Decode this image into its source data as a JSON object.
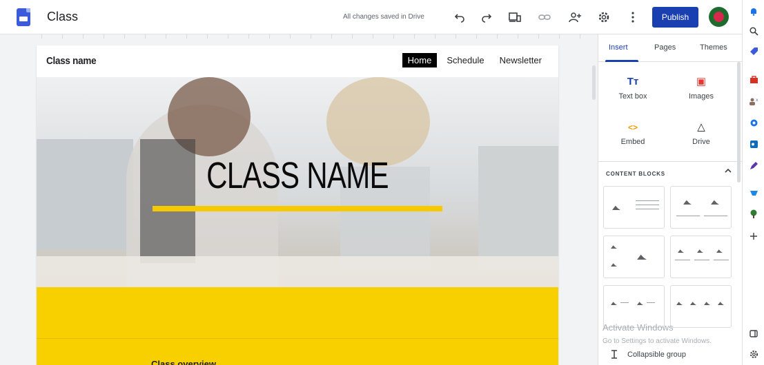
{
  "app": {
    "title": "Class",
    "save_status": "All changes saved in Drive",
    "publish_label": "Publish"
  },
  "toolbar": {
    "undo_icon": "undo-icon",
    "redo_icon": "redo-icon",
    "preview_icon": "device-preview-icon",
    "link_icon": "link-icon",
    "share_icon": "add-person-icon",
    "settings_icon": "gear-icon",
    "more_icon": "more-vertical-icon"
  },
  "site": {
    "name": "Class name",
    "nav": [
      "Home",
      "Schedule",
      "Newsletter"
    ],
    "hero_title": "CLASS NAME",
    "overview_heading": "Class overview",
    "accent_color": "#f8d000"
  },
  "panel": {
    "tabs": [
      "Insert",
      "Pages",
      "Themes"
    ],
    "active_tab": "Insert",
    "tools": [
      {
        "label": "Text box",
        "icon": "Tт",
        "color": "#1a3fb0"
      },
      {
        "label": "Images",
        "icon": "▣",
        "color": "#e53935"
      },
      {
        "label": "Embed",
        "icon": "<>",
        "color": "#f29900"
      },
      {
        "label": "Drive",
        "icon": "△",
        "color": "#3c4043"
      }
    ],
    "section_title": "CONTENT BLOCKS",
    "collapsible_label": "Collapsible group"
  },
  "watermark": {
    "line1": "Activate Windows",
    "line2": "Go to Settings to activate Windows."
  },
  "sidebar_icons": [
    "bell-icon",
    "search-icon",
    "tag-icon",
    "briefcase-icon",
    "people-icon",
    "circle-icon",
    "outlook-icon",
    "pen-icon",
    "chart-icon",
    "plant-icon",
    "plus-icon",
    "panel-icon",
    "settings-icon"
  ]
}
